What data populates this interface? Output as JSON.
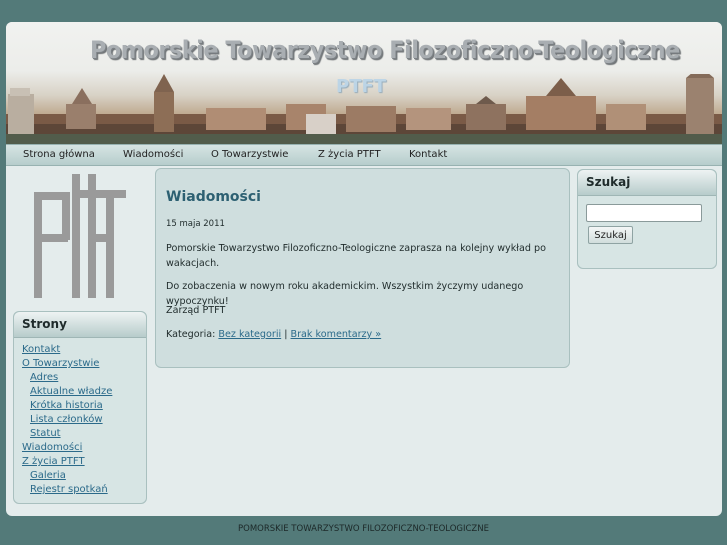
{
  "header": {
    "title": "Pomorskie Towarzystwo Filozoficzno-Teologiczne",
    "abbreviation": "PTFT"
  },
  "nav": {
    "items": [
      "Strona główna",
      "Wiadomości",
      "O Towarzystwie",
      "Z życia PTFT",
      "Kontakt"
    ]
  },
  "sidebar": {
    "logo_text": "PTFT",
    "heading": "Strony",
    "links": [
      {
        "label": "Kontakt",
        "level": 0
      },
      {
        "label": "O Towarzystwie",
        "level": 0
      },
      {
        "label": "Adres",
        "level": 1
      },
      {
        "label": "Aktualne władze",
        "level": 1
      },
      {
        "label": "Krótka historia",
        "level": 1
      },
      {
        "label": "Lista członków",
        "level": 1
      },
      {
        "label": "Statut",
        "level": 1
      },
      {
        "label": "Wiadomości",
        "level": 0
      },
      {
        "label": "Z życia PTFT",
        "level": 0
      },
      {
        "label": "Galeria",
        "level": 1
      },
      {
        "label": "Rejestr spotkań",
        "level": 1
      }
    ]
  },
  "post": {
    "title": "Wiadomości",
    "date": "15 maja 2011",
    "paragraphs": [
      "Pomorskie Towarzystwo Filozoficzno-Teologiczne zaprasza na kolejny wykład po wakacjach.",
      "Do zobaczenia w nowym roku akademickim. Wszystkim życzymy udanego wypoczynku!",
      "Zarząd PTFT"
    ],
    "category_label": "Kategoria:",
    "category_link": "Bez kategorii",
    "separator": "|",
    "comments_link": "Brak komentarzy »"
  },
  "search": {
    "heading": "Szukaj",
    "input_value": "",
    "button_label": "Szukaj"
  },
  "footer": {
    "text": "POMORSKIE TOWARZYSTWO FILOZOFICZNO-TEOLOGICZNE"
  },
  "colors": {
    "background": "#537a79",
    "accent": "#2d6072",
    "link": "#2b6a8a"
  }
}
